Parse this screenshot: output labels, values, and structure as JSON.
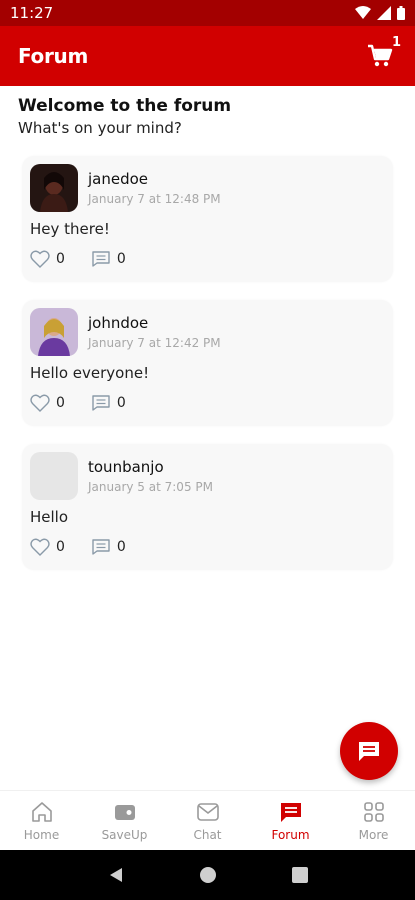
{
  "status_bar": {
    "time": "11:27"
  },
  "app_bar": {
    "title": "Forum",
    "cart_count": "1"
  },
  "welcome": {
    "title": "Welcome to the forum",
    "subtitle": "What's on your mind?"
  },
  "posts": [
    {
      "username": "janedoe",
      "time": "January 7 at 12:48 PM",
      "body": "Hey there!",
      "likes": "0",
      "comments": "0",
      "avatar": "dark-photo"
    },
    {
      "username": "johndoe",
      "time": "January 7 at 12:42 PM",
      "body": "Hello everyone!",
      "likes": "0",
      "comments": "0",
      "avatar": "purple-photo"
    },
    {
      "username": "tounbanjo",
      "time": "January 5 at 7:05 PM",
      "body": "Hello",
      "likes": "0",
      "comments": "0",
      "avatar": "placeholder"
    }
  ],
  "bottom_nav": {
    "items": [
      {
        "label": "Home",
        "icon": "home-icon"
      },
      {
        "label": "SaveUp",
        "icon": "wallet-icon"
      },
      {
        "label": "Chat",
        "icon": "mail-icon"
      },
      {
        "label": "Forum",
        "icon": "forum-icon",
        "active": true
      },
      {
        "label": "More",
        "icon": "grid-icon"
      }
    ]
  },
  "colors": {
    "brand": "#d10000",
    "status_bar": "#a30000",
    "muted": "#9a9a9a"
  }
}
